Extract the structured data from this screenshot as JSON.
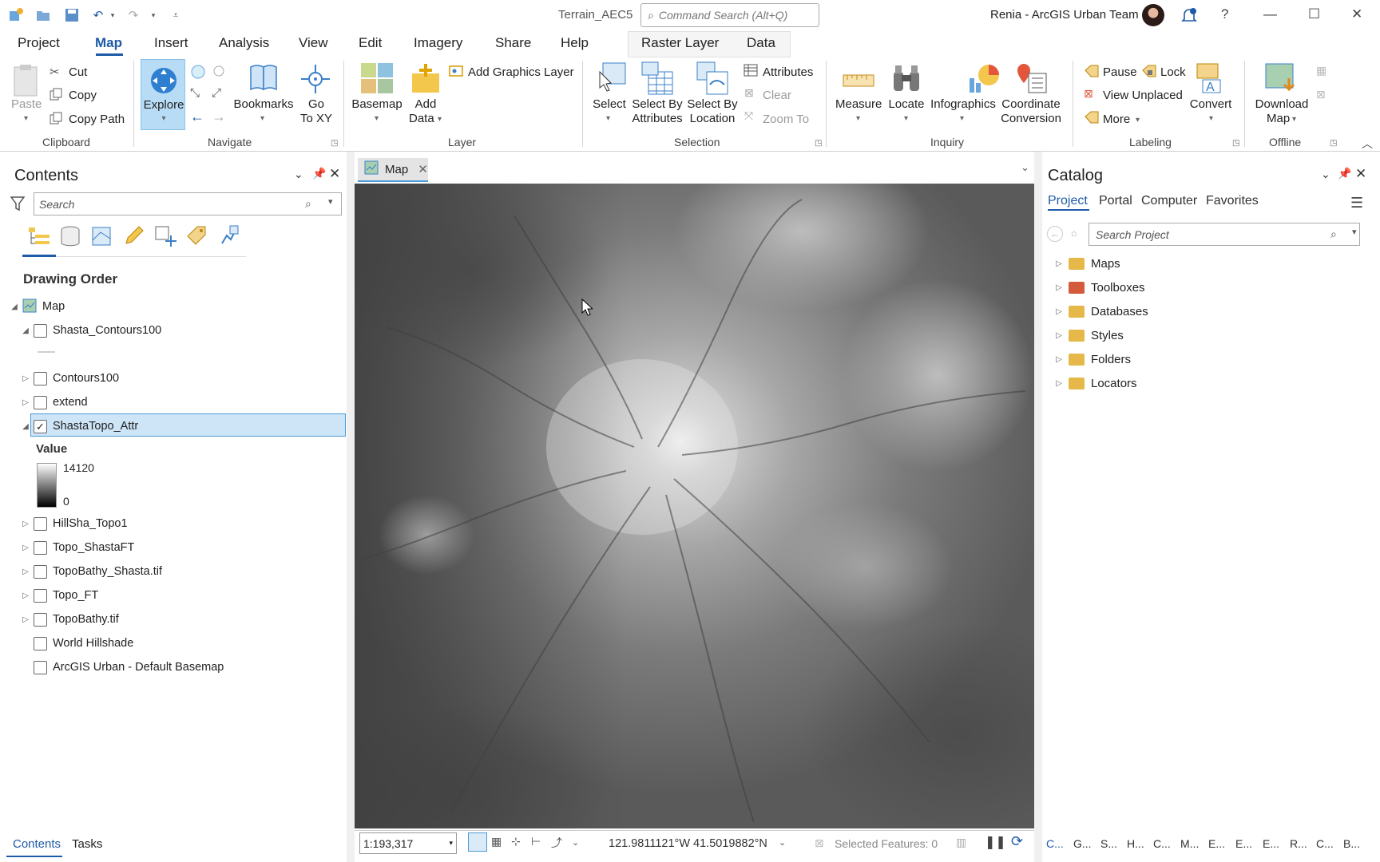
{
  "titlebar": {
    "project_title": "Terrain_AEC5",
    "command_search_placeholder": "Command Search (Alt+Q)",
    "user": "Renia - ArcGIS Urban Team",
    "help": "?"
  },
  "menu": {
    "tabs": [
      "Project",
      "Map",
      "Insert",
      "Analysis",
      "View",
      "Edit",
      "Imagery",
      "Share",
      "Help"
    ],
    "active": "Map",
    "context_tabs": [
      "Raster Layer",
      "Data"
    ]
  },
  "ribbon": {
    "clipboard": {
      "paste": "Paste",
      "cut": "Cut",
      "copy": "Copy",
      "copy_path": "Copy Path",
      "group": "Clipboard"
    },
    "navigate": {
      "explore": "Explore",
      "bookmarks": "Bookmarks",
      "go_to_xy_1": "Go",
      "go_to_xy_2": "To XY",
      "group": "Navigate"
    },
    "layer": {
      "basemap": "Basemap",
      "add_data_1": "Add",
      "add_data_2": "Data",
      "add_graphics": "Add Graphics Layer",
      "group": "Layer"
    },
    "selection": {
      "select": "Select",
      "sba_1": "Select By",
      "sba_2": "Attributes",
      "sbl_1": "Select By",
      "sbl_2": "Location",
      "attributes": "Attributes",
      "clear": "Clear",
      "zoom_to": "Zoom To",
      "group": "Selection"
    },
    "inquiry": {
      "measure": "Measure",
      "locate": "Locate",
      "infographics": "Infographics",
      "coord_1": "Coordinate",
      "coord_2": "Conversion",
      "group": "Inquiry"
    },
    "labeling": {
      "pause": "Pause",
      "lock": "Lock",
      "view_unplaced": "View Unplaced",
      "more": "More",
      "convert": "Convert",
      "group": "Labeling"
    },
    "offline": {
      "download_1": "Download",
      "download_2": "Map",
      "group": "Offline"
    }
  },
  "contents": {
    "title": "Contents",
    "search_placeholder": "Search",
    "section": "Drawing Order",
    "map_label": "Map",
    "layers": [
      {
        "name": "Shasta_Contours100",
        "checked": false
      },
      {
        "name": "Contours100",
        "checked": false
      },
      {
        "name": "extend",
        "checked": false
      },
      {
        "name": "ShastaTopo_Attr",
        "checked": true
      },
      {
        "name": "HillSha_Topo1",
        "checked": false
      },
      {
        "name": "Topo_ShastaFT",
        "checked": false
      },
      {
        "name": "TopoBathy_Shasta.tif",
        "checked": false
      },
      {
        "name": "Topo_FT",
        "checked": false
      },
      {
        "name": "TopoBathy.tif",
        "checked": false
      },
      {
        "name": "World Hillshade",
        "checked": false
      },
      {
        "name": "ArcGIS Urban - Default Basemap",
        "checked": false
      }
    ],
    "legend": {
      "label": "Value",
      "max": "14120",
      "min": "0"
    },
    "bottom_tabs": [
      "Contents",
      "Tasks"
    ]
  },
  "map": {
    "tab_label": "Map",
    "scale": "1:193,317",
    "coordinates": "121.9811121°W 41.5019882°N",
    "selected_features": "Selected Features: 0"
  },
  "catalog": {
    "title": "Catalog",
    "tabs": [
      "Project",
      "Portal",
      "Computer",
      "Favorites"
    ],
    "active_tab": "Project",
    "search_placeholder": "Search Project",
    "items": [
      "Maps",
      "Toolboxes",
      "Databases",
      "Styles",
      "Folders",
      "Locators"
    ],
    "bottom_tabs": [
      "C...",
      "G...",
      "S...",
      "H...",
      "C...",
      "M...",
      "E...",
      "E...",
      "E...",
      "R...",
      "C...",
      "B..."
    ]
  },
  "colors": {
    "accent": "#1e5aa8",
    "selection": "#cde5f7",
    "explore_active": "#b8dcf5"
  }
}
